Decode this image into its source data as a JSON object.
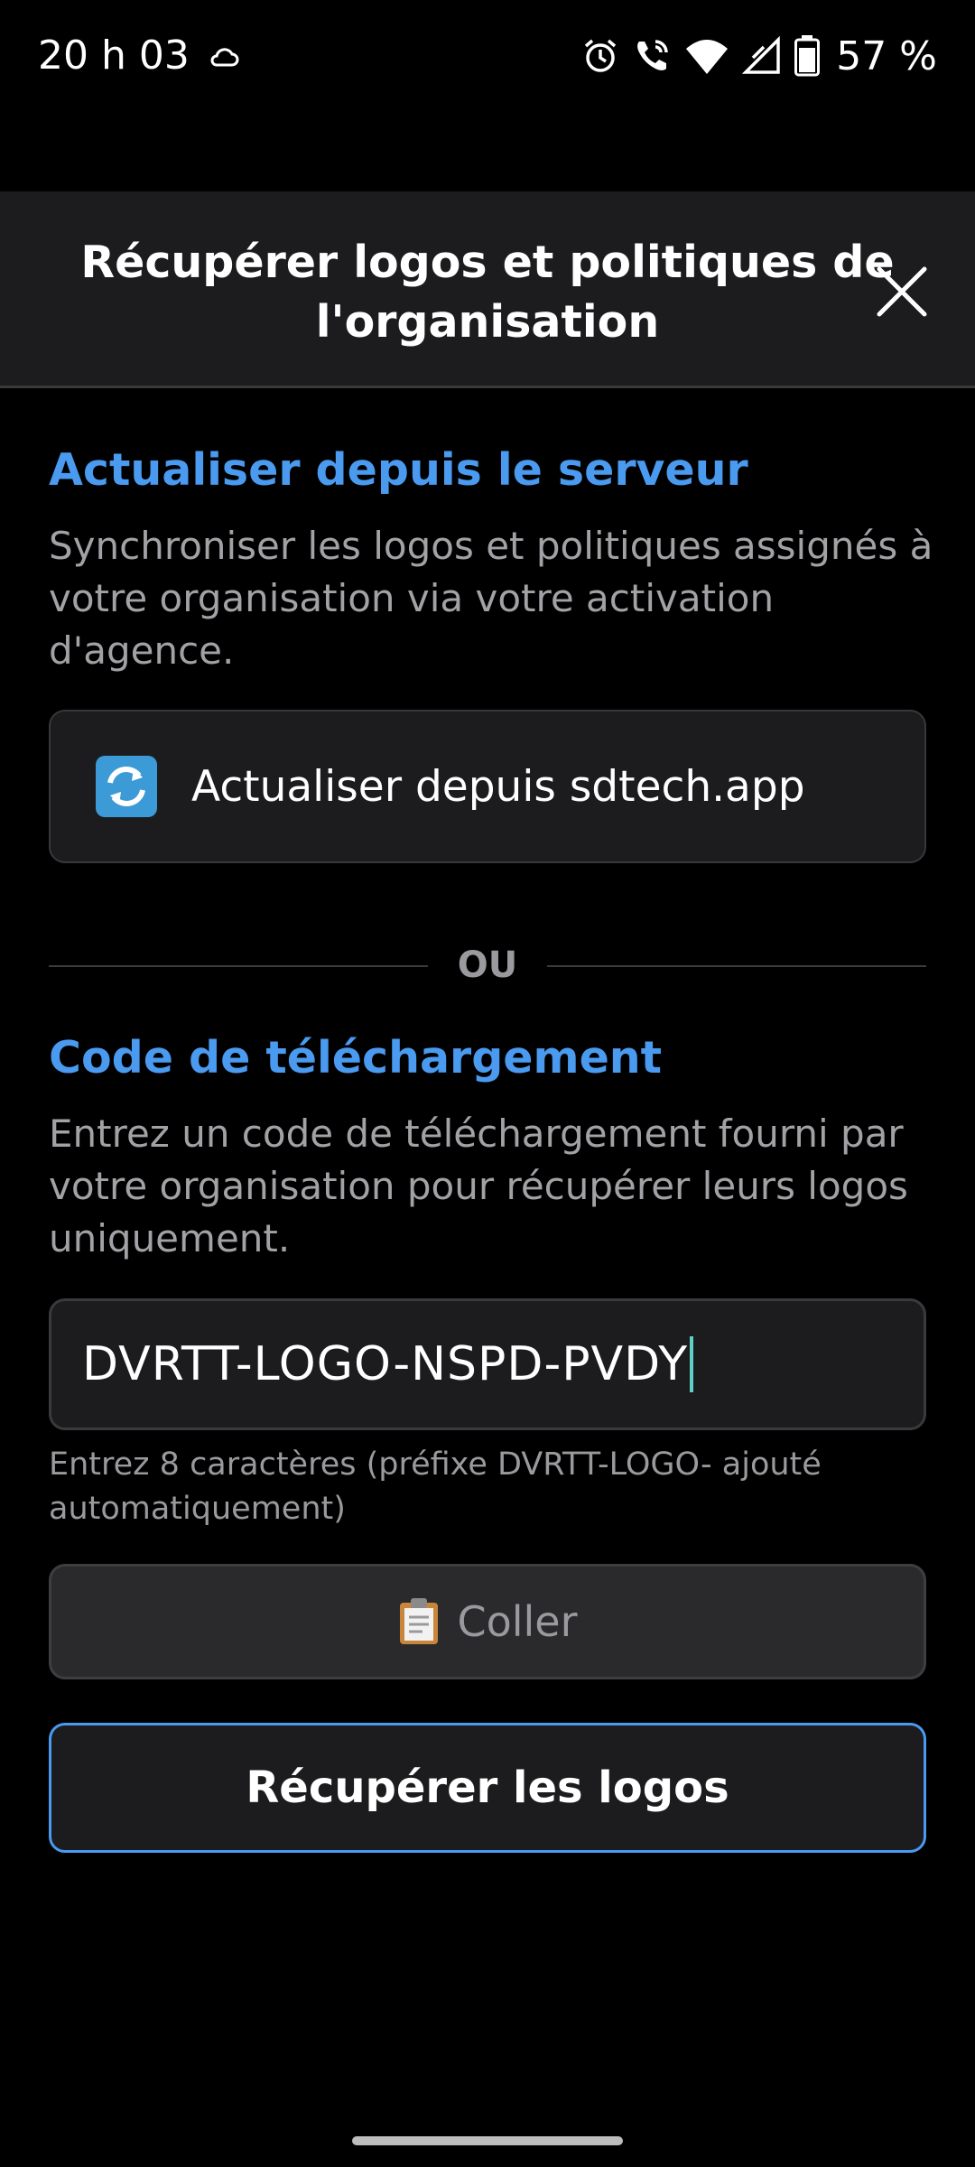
{
  "status_bar": {
    "time": "20 h 03",
    "battery_text": "57 %",
    "icons": [
      "cloud-icon",
      "alarm-icon",
      "wifi-calling-icon",
      "wifi-icon",
      "signal-icon",
      "battery-icon"
    ]
  },
  "header": {
    "title": "Récupérer logos et politiques de l'organisation",
    "close_icon": "close-icon"
  },
  "server_section": {
    "title": "Actualiser depuis le serveur",
    "description": "Synchroniser les logos et politiques assignés à votre organisation via votre activation d'agence.",
    "refresh_button": {
      "icon": "refresh-arrows-icon",
      "label": "Actualiser depuis sdtech.app"
    }
  },
  "divider": {
    "text": "OU"
  },
  "code_section": {
    "title": "Code de téléchargement",
    "description": "Entrez un code de téléchargement fourni par votre organisation pour récupérer leurs logos uniquement.",
    "input_value": "DVRTT-LOGO-NSPD-PVDY",
    "helper_text": "Entrez 8 caractères (préfixe DVRTT-LOGO- ajouté automatiquement)",
    "paste_button": {
      "icon": "clipboard-icon",
      "label": "Coller"
    },
    "fetch_button": {
      "label": "Récupérer les logos"
    }
  },
  "colors": {
    "accent": "#4a9af0",
    "background": "#000000",
    "surface": "#1c1c1e",
    "muted_text": "#a2a2a6",
    "caret": "#5fd0c8"
  }
}
